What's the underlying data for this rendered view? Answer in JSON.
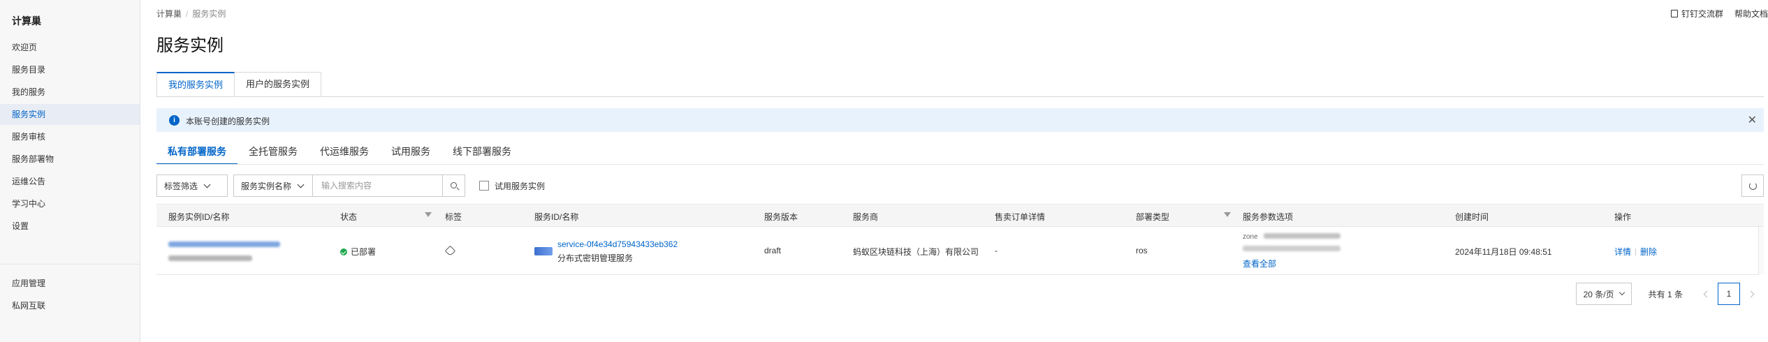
{
  "sidebar": {
    "title": "计算巢",
    "items": [
      {
        "label": "欢迎页"
      },
      {
        "label": "服务目录"
      },
      {
        "label": "我的服务"
      },
      {
        "label": "服务实例",
        "active": true
      },
      {
        "label": "服务审核"
      },
      {
        "label": "服务部署物"
      },
      {
        "label": "运维公告"
      },
      {
        "label": "学习中心"
      },
      {
        "label": "设置"
      }
    ],
    "bottom_items": [
      {
        "label": "应用管理"
      },
      {
        "label": "私网互联"
      }
    ]
  },
  "breadcrumb": {
    "root": "计算巢",
    "current": "服务实例"
  },
  "header_links": {
    "dingtalk": "钉钉交流群",
    "help": "帮助文档"
  },
  "page_title": "服务实例",
  "main_tabs": [
    {
      "label": "我的服务实例",
      "active": true
    },
    {
      "label": "用户的服务实例"
    }
  ],
  "alert": {
    "text": "本账号创建的服务实例"
  },
  "sub_tabs": [
    {
      "label": "私有部署服务",
      "active": true
    },
    {
      "label": "全托管服务"
    },
    {
      "label": "代运维服务"
    },
    {
      "label": "试用服务"
    },
    {
      "label": "线下部署服务"
    }
  ],
  "filters": {
    "tag_filter": "标签筛选",
    "search_field": "服务实例名称",
    "search_placeholder": "输入搜索内容",
    "search_value": "",
    "trial_checkbox_label": "试用服务实例",
    "trial_checked": false
  },
  "table": {
    "columns": {
      "instance": "服务实例ID/名称",
      "status": "状态",
      "tags": "标签",
      "service": "服务ID/名称",
      "version": "服务版本",
      "provider": "服务商",
      "order": "售卖订单详情",
      "deploy_type": "部署类型",
      "params": "服务参数选项",
      "created": "创建时间",
      "actions": "操作"
    },
    "rows": [
      {
        "status": "已部署",
        "service_id": "service-0f4e34d75943433eb362",
        "service_name": "分布式密钥管理服务",
        "version": "draft",
        "provider": "蚂蚁区块链科技（上海）有限公司",
        "order": "-",
        "deploy_type": "ros",
        "params_prefix": "zone",
        "params_more": "查看全部",
        "created": "2024年11月18日 09:48:51",
        "action_detail": "详情",
        "action_delete": "删除"
      }
    ]
  },
  "pagination": {
    "page_size": "20 条/页",
    "total": "共有 1 条",
    "current_page": "1"
  },
  "colors": {
    "accent": "#0064c8",
    "success": "#1fa84c",
    "alert_bg": "#e8f2fd"
  }
}
